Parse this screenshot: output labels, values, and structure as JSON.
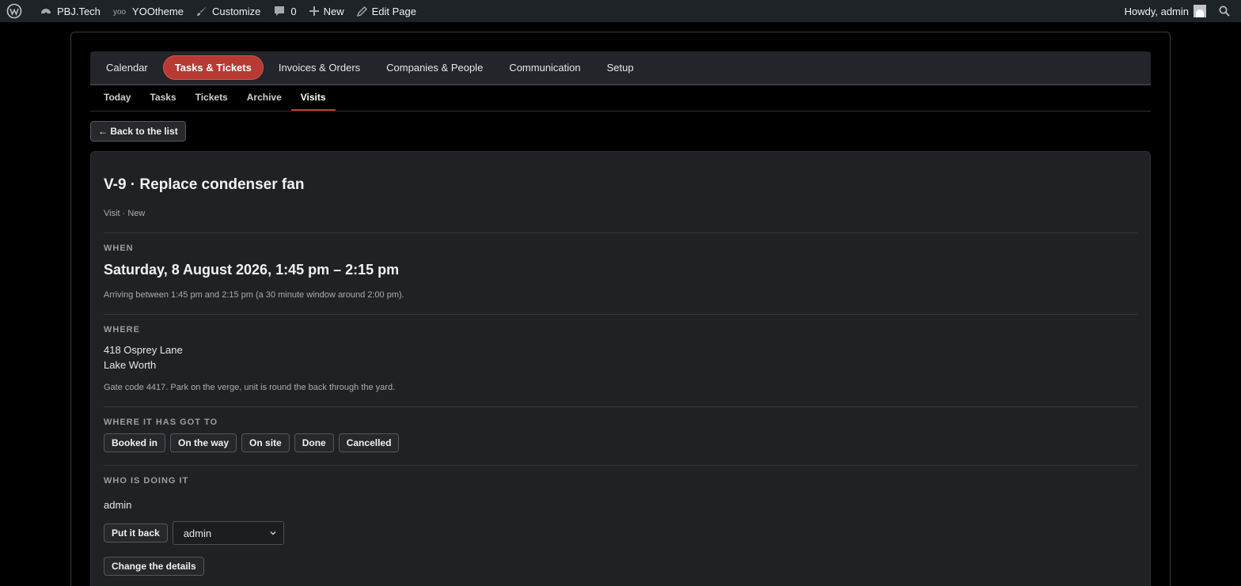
{
  "adminbar": {
    "site_name": "PBJ.Tech",
    "theme": "YOOtheme",
    "customize": "Customize",
    "comments_count": "0",
    "new": "New",
    "edit_page": "Edit Page",
    "greeting": "Howdy, admin"
  },
  "main_nav": [
    "Calendar",
    "Tasks & Tickets",
    "Invoices & Orders",
    "Companies & People",
    "Communication",
    "Setup"
  ],
  "main_nav_active": "Tasks & Tickets",
  "sub_nav": [
    "Today",
    "Tasks",
    "Tickets",
    "Archive",
    "Visits"
  ],
  "sub_nav_active": "Visits",
  "back_label": "← Back to the list",
  "visit": {
    "title": "V-9 · Replace condenser fan",
    "meta": "Visit · New",
    "when_label": "WHEN",
    "when_value": "Saturday, 8 August 2026, 1:45 pm – 2:15 pm",
    "when_note": "Arriving between 1:45 pm and 2:15 pm (a 30 minute window around 2:00 pm).",
    "where_label": "WHERE",
    "address_line1": "418 Osprey Lane",
    "address_line2": "Lake Worth",
    "where_note": "Gate code 4417. Park on the verge, unit is round the back through the yard.",
    "status_label": "WHERE IT HAS GOT TO",
    "statuses": [
      "Booked in",
      "On the way",
      "On site",
      "Done",
      "Cancelled"
    ],
    "who_label": "WHO IS DOING IT",
    "assignee": "admin",
    "put_back_label": "Put it back",
    "assignee_select_value": "admin",
    "change_details_label": "Change the details"
  },
  "colors": {
    "accent": "#b73a34",
    "adminbar_bg": "#1d2327",
    "card_bg": "#1f2125"
  }
}
